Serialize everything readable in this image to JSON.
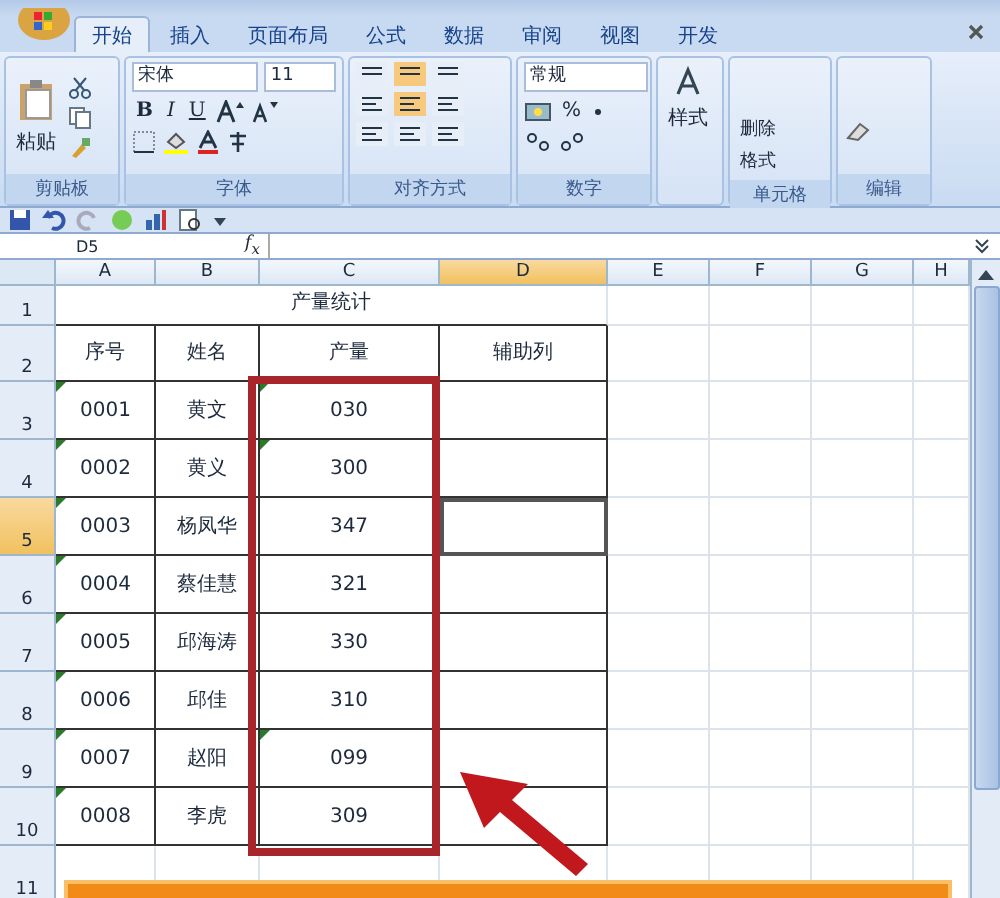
{
  "tabs": [
    {
      "label": "开始",
      "selected": true
    },
    {
      "label": "插入",
      "selected": false
    },
    {
      "label": "页面布局",
      "selected": false
    },
    {
      "label": "公式",
      "selected": false
    },
    {
      "label": "数据",
      "selected": false
    },
    {
      "label": "审阅",
      "selected": false
    },
    {
      "label": "视图",
      "selected": false
    },
    {
      "label": "开发",
      "selected": false
    }
  ],
  "ribbon": {
    "clipboard": {
      "paste": "粘贴",
      "label": "剪贴板"
    },
    "font": {
      "name": "宋体",
      "size": "11",
      "bold": "B",
      "italic": "I",
      "underline": "U",
      "label": "字体"
    },
    "alignment": {
      "label": "对齐方式"
    },
    "number": {
      "format": "常规",
      "percent": "%",
      "label": "数字"
    },
    "styles": {
      "button": "样式"
    },
    "cells": {
      "delete": "删除",
      "format": "格式",
      "label": "单元格"
    },
    "editing": {
      "label": "编辑"
    }
  },
  "formula_bar": {
    "name_box": "D5",
    "fx": "f$_{x}$"
  },
  "sheet": {
    "columns": [
      {
        "label": "A",
        "selected": false
      },
      {
        "label": "B",
        "selected": false
      },
      {
        "label": "C",
        "selected": false
      },
      {
        "label": "D",
        "selected": true
      },
      {
        "label": "E",
        "selected": false
      },
      {
        "label": "F",
        "selected": false
      },
      {
        "label": "G",
        "selected": false
      },
      {
        "label": "H",
        "selected": false
      }
    ],
    "title_row": {
      "header": "1",
      "selected": false,
      "title": "产量统计"
    },
    "rows": [
      {
        "header": "2",
        "selected": false,
        "cells": [
          {
            "text": "序号",
            "flag": false
          },
          {
            "text": "姓名",
            "flag": false
          },
          {
            "text": "产量",
            "flag": false
          },
          {
            "text": "辅助列",
            "selected": false
          }
        ]
      },
      {
        "header": "3",
        "selected": false,
        "cells": [
          {
            "text": "0001",
            "flag": true
          },
          {
            "text": "黄文",
            "flag": false
          },
          {
            "text": "030",
            "flag": true
          },
          {
            "selected": false
          }
        ]
      },
      {
        "header": "4",
        "selected": false,
        "cells": [
          {
            "text": "0002",
            "flag": true
          },
          {
            "text": "黄义",
            "flag": false
          },
          {
            "text": "300",
            "flag": true
          },
          {
            "selected": false
          }
        ]
      },
      {
        "header": "5",
        "selected": true,
        "cells": [
          {
            "text": "0003",
            "flag": true
          },
          {
            "text": "杨凤华",
            "flag": false
          },
          {
            "text": "347",
            "flag": false
          },
          {
            "selected": true
          }
        ]
      },
      {
        "header": "6",
        "selected": false,
        "cells": [
          {
            "text": "0004",
            "flag": true
          },
          {
            "text": "蔡佳慧",
            "flag": false
          },
          {
            "text": "321",
            "flag": false
          },
          {
            "selected": false
          }
        ]
      },
      {
        "header": "7",
        "selected": false,
        "cells": [
          {
            "text": "0005",
            "flag": true
          },
          {
            "text": "邱海涛",
            "flag": false
          },
          {
            "text": "330",
            "flag": false
          },
          {
            "selected": false
          }
        ]
      },
      {
        "header": "8",
        "selected": false,
        "cells": [
          {
            "text": "0006",
            "flag": true
          },
          {
            "text": "邱佳",
            "flag": false
          },
          {
            "text": "310",
            "flag": false
          },
          {
            "selected": false
          }
        ]
      },
      {
        "header": "9",
        "selected": false,
        "cells": [
          {
            "text": "0007",
            "flag": true
          },
          {
            "text": "赵阳",
            "flag": false
          },
          {
            "text": "099",
            "flag": true
          },
          {
            "selected": false
          }
        ]
      },
      {
        "header": "10",
        "selected": false,
        "cells": [
          {
            "text": "0008",
            "flag": true
          },
          {
            "text": "李虎",
            "flag": false
          },
          {
            "text": "309",
            "flag": false
          },
          {
            "selected": false
          }
        ]
      }
    ],
    "last_row": {
      "header": "11",
      "selected": false
    }
  }
}
